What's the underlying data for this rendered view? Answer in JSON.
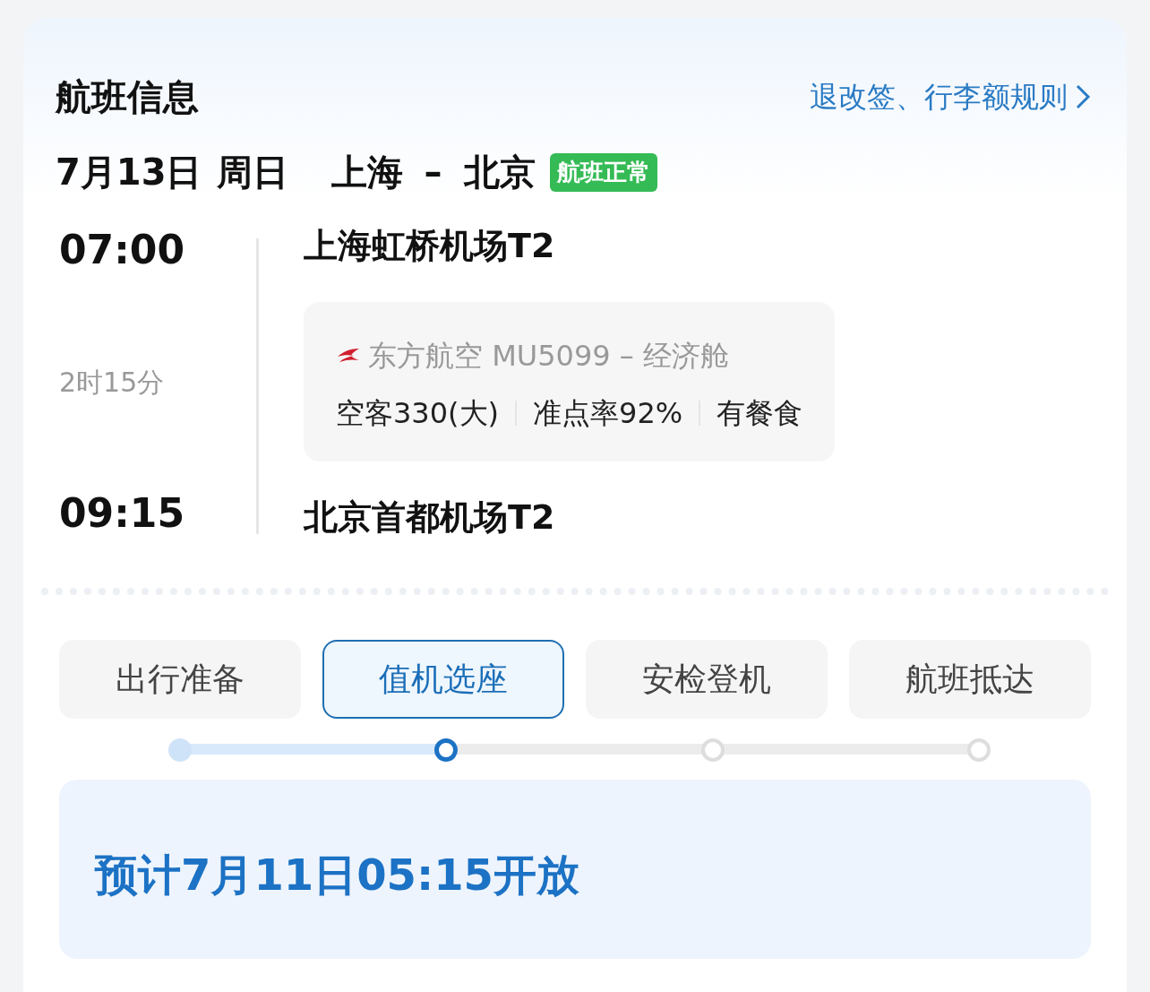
{
  "header": {
    "title": "航班信息",
    "rules_link": "退改签、行李额规则"
  },
  "route": {
    "date": "7月13日",
    "weekday": "周日",
    "from_city": "上海",
    "dash": "–",
    "to_city": "北京",
    "status": "航班正常"
  },
  "departure": {
    "time": "07:00",
    "airport": "上海虹桥机场T2"
  },
  "duration": "2时15分",
  "segment": {
    "airline_line": "东方航空 MU5099 – 经济舱",
    "details": [
      "空客330(大)",
      "准点率92%",
      "有餐食"
    ]
  },
  "arrival": {
    "time": "09:15",
    "airport": "北京首都机场T2"
  },
  "stages": [
    {
      "label": "出行准备",
      "selected": false
    },
    {
      "label": "值机选座",
      "selected": true
    },
    {
      "label": "安检登机",
      "selected": false
    },
    {
      "label": "航班抵达",
      "selected": false
    }
  ],
  "notice": "预计7月11日05:15开放"
}
